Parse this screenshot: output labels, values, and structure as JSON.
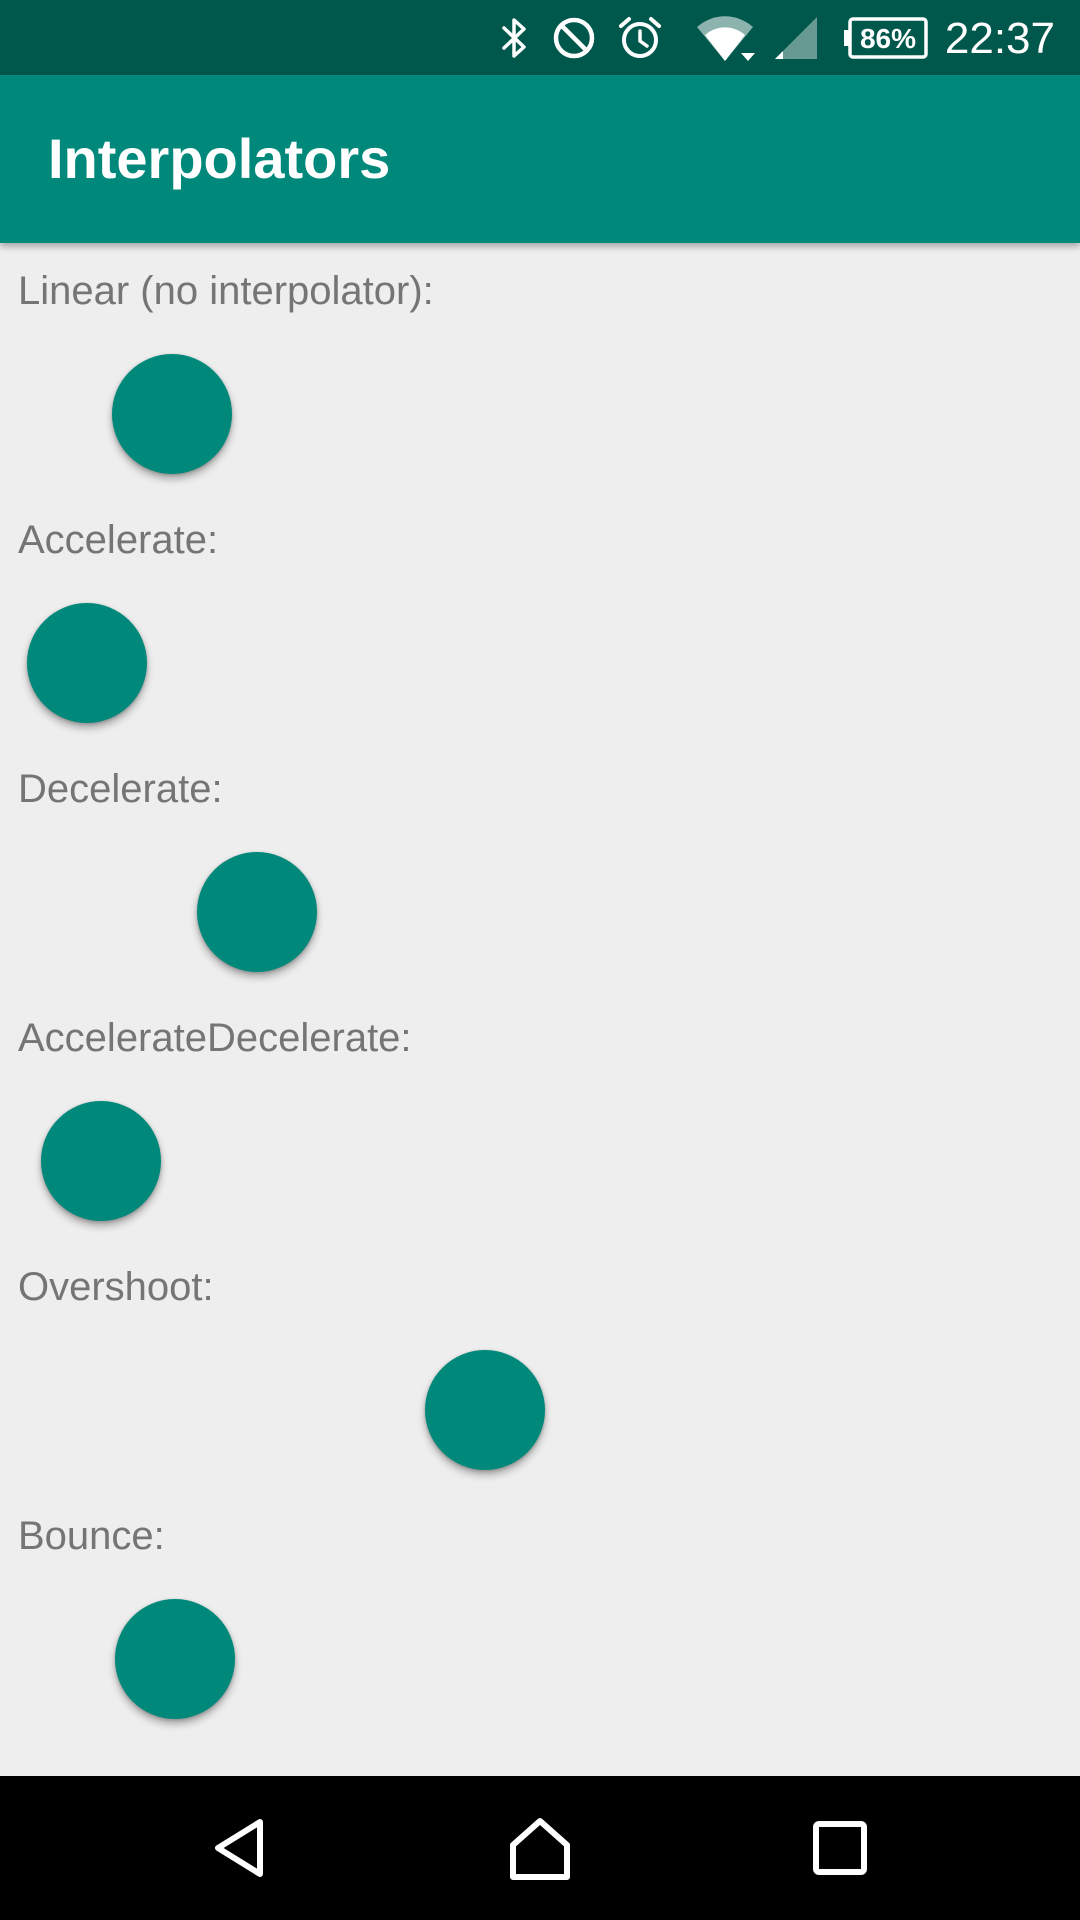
{
  "status_bar": {
    "battery_percent": "86%",
    "time": "22:37",
    "icons": [
      "bluetooth-icon",
      "do-not-disturb-icon",
      "alarm-icon",
      "wifi-icon",
      "cell-signal-icon",
      "battery-icon"
    ]
  },
  "app_bar": {
    "title": "Interpolators"
  },
  "interpolators": [
    {
      "label": "Linear (no interpolator):"
    },
    {
      "label": "Accelerate:"
    },
    {
      "label": "Decelerate:"
    },
    {
      "label": "AccelerateDecelerate:"
    },
    {
      "label": "Overshoot:"
    },
    {
      "label": "Bounce:"
    }
  ],
  "colors": {
    "status_bar": "#00574b",
    "primary": "#00897b",
    "background": "#eeeeee",
    "label_text": "#757575",
    "nav_bar": "#000000"
  },
  "nav_bar": {
    "buttons": [
      "back-icon",
      "home-icon",
      "recents-icon"
    ]
  }
}
